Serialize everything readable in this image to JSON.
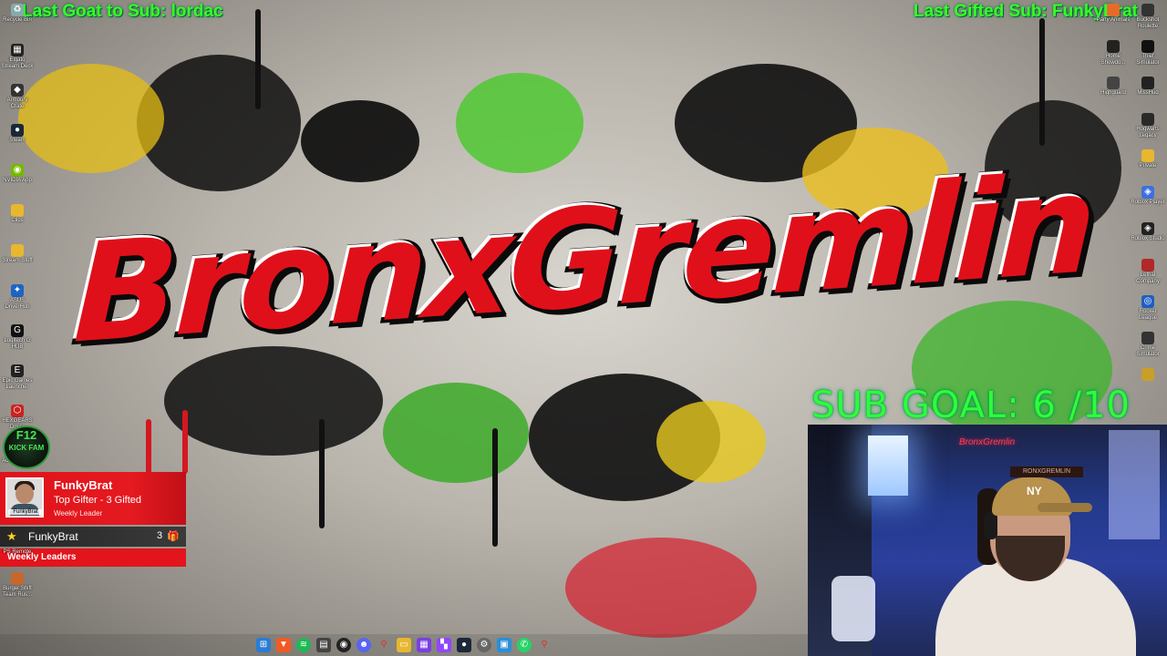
{
  "overlay": {
    "last_goat": "Last Goat to Sub: lordac",
    "last_gifted": "Last Gifted Sub: FunkyBrat",
    "logo_text": "BronxGremlin",
    "sub_goal": "SUB GOAL: 6 /10"
  },
  "desktop_left": [
    {
      "label": "Recycle Bin",
      "icon": "recycle-bin-icon"
    },
    {
      "label": "Elgato Stream Deck",
      "icon": "stream-deck-icon"
    },
    {
      "label": "Armoury Crate",
      "icon": "armoury-crate-icon"
    },
    {
      "label": "Steam",
      "icon": "steam-icon"
    },
    {
      "label": "NVIDIA App",
      "icon": "nvidia-icon"
    },
    {
      "label": "Clips",
      "icon": "folder-icon"
    },
    {
      "label": "Stream Stuff",
      "icon": "folder-icon"
    },
    {
      "label": "ASUS DriverHub",
      "icon": "asus-icon"
    },
    {
      "label": "Logitech G HUB",
      "icon": "logitech-icon"
    },
    {
      "label": "Epic Games Launcher",
      "icon": "epic-games-icon"
    },
    {
      "label": "HEXGEARS Driver",
      "icon": "hexgears-icon"
    },
    {
      "label": "Ac Link Web",
      "icon": "app-icon"
    }
  ],
  "desktop_left_bottom": [
    {
      "label": "PS Remote",
      "icon": "ps-remote-icon"
    },
    {
      "label": "Burger Shift Team Rus...",
      "icon": "game-icon"
    }
  ],
  "desktop_right": [
    {
      "label": "Party Animals",
      "icon": "game-icon"
    },
    {
      "label": "Buckshot Roulette",
      "icon": "game-icon"
    },
    {
      "label": "Home Showdo...",
      "icon": "game-icon"
    },
    {
      "label": "Thief Simulator",
      "icon": "game-icon"
    },
    {
      "label": "Highguard",
      "icon": "game-icon"
    },
    {
      "label": "MissHud",
      "icon": "game-icon"
    },
    {
      "label": "Hogwarts Legacy",
      "icon": "game-icon"
    },
    {
      "label": "Private",
      "icon": "folder-icon"
    },
    {
      "label": "Roblox Player",
      "icon": "roblox-icon"
    },
    {
      "label": "Roblox Studio",
      "icon": "roblox-studio-icon"
    },
    {
      "label": "Lethal Company",
      "icon": "game-icon"
    },
    {
      "label": "Rocket League",
      "icon": "rocket-league-icon"
    },
    {
      "label": "Crime Simulator",
      "icon": "game-icon"
    },
    {
      "label": "",
      "icon": "app-icon"
    }
  ],
  "badge": {
    "line1": "F12",
    "line2": "KICK FAM"
  },
  "leaderboard": {
    "top_name": "FunkyBrat",
    "top_desc": "Top Gifter - 3 Gifted",
    "period": "Weekly Leader",
    "avatar_caption": "FunkyBrat",
    "row_name": "FunkyBrat",
    "row_count": "3",
    "footer": "Weekly Leaders"
  },
  "webcam": {
    "neon_sign": "BronxGremlin",
    "plate": "RONXGREMLIN",
    "cap_logo": "NY"
  },
  "taskbar": [
    {
      "icon": "windows-start-icon"
    },
    {
      "icon": "brave-browser-icon"
    },
    {
      "icon": "spotify-icon"
    },
    {
      "icon": "calendar-icon"
    },
    {
      "icon": "obs-icon"
    },
    {
      "icon": "discord-icon"
    },
    {
      "icon": "location-pin-icon"
    },
    {
      "icon": "file-explorer-icon"
    },
    {
      "icon": "app-grid-icon"
    },
    {
      "icon": "twitch-icon"
    },
    {
      "icon": "steam-icon"
    },
    {
      "icon": "settings-icon"
    },
    {
      "icon": "photos-icon"
    },
    {
      "icon": "whatsapp-icon"
    },
    {
      "icon": "pin-icon"
    }
  ],
  "colors": {
    "overlay_green": "#37ff27",
    "logo_red": "#e0101a",
    "leader_red": "#e2141c"
  }
}
